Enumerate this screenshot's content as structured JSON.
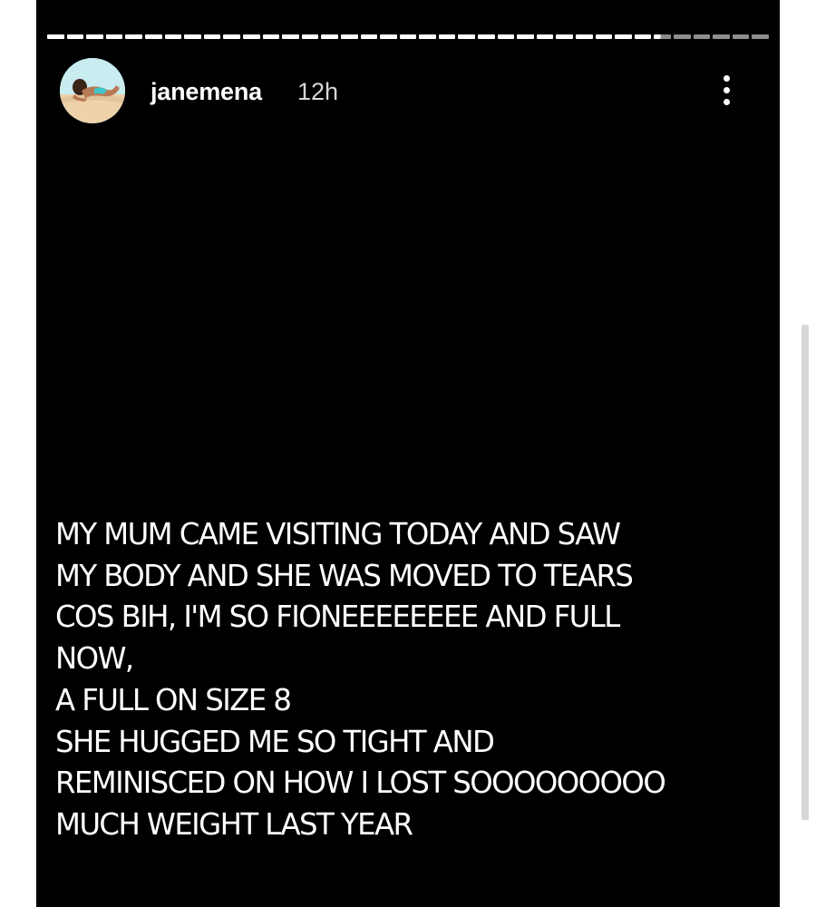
{
  "story": {
    "progress": {
      "segments_total": 37,
      "segments_viewed": 31,
      "current_segment_fraction": 0.4
    },
    "user": {
      "username": "janemena",
      "avatar": "profile-photo",
      "timestamp": "12h"
    },
    "menu_icon": "more-vertical-icon",
    "caption_lines": [
      "MY MUM CAME VISITING TODAY AND SAW",
      "MY BODY AND SHE WAS MOVED TO TEARS",
      "COS BIH, I'M SO FIONEEEEEEEE AND FULL",
      "NOW,",
      "A FULL ON SIZE 8",
      "SHE HUGGED ME SO TIGHT AND",
      "REMINISCED ON HOW I LOST SOOOOOOOOO",
      "MUCH WEIGHT LAST YEAR"
    ],
    "colors": {
      "background": "#000000",
      "text": "#ffffff",
      "progress_inactive": "#8d8d8d"
    }
  }
}
